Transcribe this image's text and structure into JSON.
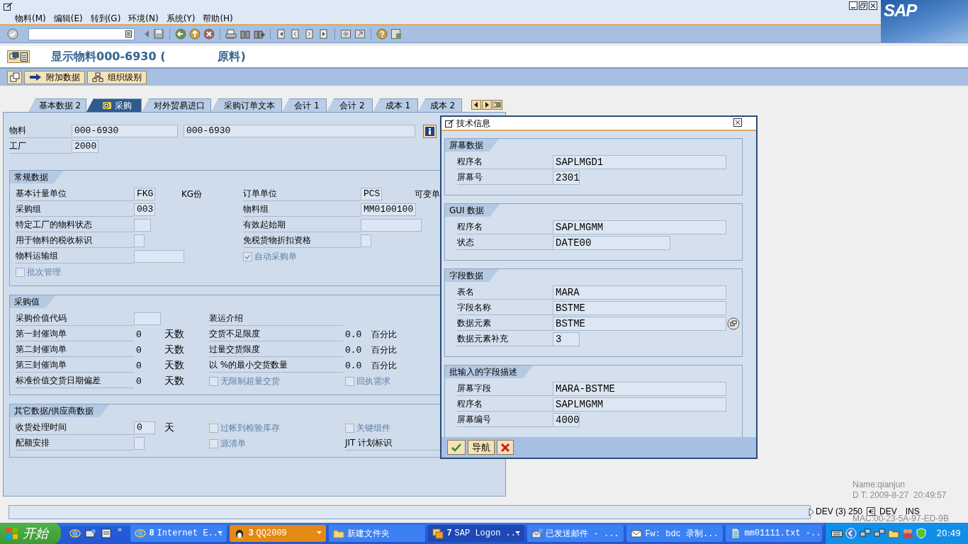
{
  "window": {
    "logo": "SAP"
  },
  "menu": [
    {
      "label": "物料(M)"
    },
    {
      "label": "编辑(E)"
    },
    {
      "label": "转到(G)"
    },
    {
      "label": "环境(N)"
    },
    {
      "label": "系统(Y)"
    },
    {
      "label": "帮助(H)"
    }
  ],
  "title": {
    "start": "显示物料000-6930 (",
    "end": "原料)"
  },
  "app_toolbar": [
    {
      "kind": "arrow",
      "label": "附加数据"
    },
    {
      "kind": "hierarchy",
      "label": "组织级别"
    }
  ],
  "tabs": [
    {
      "label": "基本数据 2",
      "selected": false
    },
    {
      "label": "采购",
      "selected": true
    },
    {
      "label": "对外贸易进口",
      "selected": false
    },
    {
      "label": "采购订单文本",
      "selected": false
    },
    {
      "label": "会计 1",
      "selected": false
    },
    {
      "label": "会计 2",
      "selected": false
    },
    {
      "label": "成本 1",
      "selected": false
    },
    {
      "label": "成本 2",
      "selected": false
    }
  ],
  "header": {
    "material_label": "物料",
    "material": "000-6930",
    "description": "000-6930",
    "plant_label": "工厂",
    "plant": "2000"
  },
  "groups": [
    {
      "title": "常规数据",
      "rows": [
        [
          {
            "kind": "field",
            "label": "基本计量单位",
            "value": "FKG",
            "unit": "KG份"
          },
          {
            "kind": "field",
            "label": "订单单位",
            "value": "PCS",
            "unit": "可变单"
          }
        ],
        [
          {
            "kind": "field",
            "label": "采购组",
            "value": "003"
          },
          {
            "kind": "field",
            "label": "物料组",
            "value": "MM0100100"
          }
        ],
        [
          {
            "kind": "field",
            "label": "特定工厂的物料状态"
          },
          {
            "kind": "field",
            "label": "有效起始期"
          }
        ],
        [
          {
            "kind": "field",
            "label": "用于物料的税收标识"
          },
          {
            "kind": "field",
            "label": "免税货物折扣资格"
          }
        ],
        [
          {
            "kind": "field",
            "label": "物料运输组"
          },
          {
            "kind": "checkbox",
            "label": "自动采购单",
            "checked": true,
            "disabled": true
          }
        ],
        [
          {
            "kind": "checkbox",
            "label": "批次管理",
            "checked": false,
            "disabled": true
          }
        ]
      ]
    },
    {
      "title": "采购值",
      "rows": [
        [
          {
            "kind": "field",
            "label": "采购价值代码"
          },
          {
            "kind": "label",
            "label": "装运介绍"
          }
        ],
        [
          {
            "kind": "output",
            "label": "第一封催询单",
            "value": "0",
            "unit": "天数"
          },
          {
            "kind": "output",
            "label": "交货不足限度",
            "value": "0.0",
            "unit": "百分比"
          }
        ],
        [
          {
            "kind": "output",
            "label": "第二封催询单",
            "value": "0",
            "unit": "天数"
          },
          {
            "kind": "output",
            "label": "过量交货限度",
            "value": "0.0",
            "unit": "百分比"
          }
        ],
        [
          {
            "kind": "output",
            "label": "第三封催询单",
            "value": "0",
            "unit": "天数"
          },
          {
            "kind": "output",
            "label": "以 %的最小交货数量",
            "value": "0.0",
            "unit": "百分比"
          }
        ],
        [
          {
            "kind": "output",
            "label": "标准价值交货日期偏差",
            "value": "0",
            "unit": "天数"
          },
          {
            "kind": "checkbox",
            "label": "无限制超量交货",
            "checked": false,
            "disabled": true
          },
          {
            "kind": "checkbox",
            "label": "回执需求",
            "checked": false,
            "disabled": true
          }
        ]
      ]
    },
    {
      "title": "其它数据/供应商数据",
      "rows": [
        [
          {
            "kind": "field",
            "label": "收货处理时间",
            "value": "0",
            "unit": "天"
          },
          {
            "kind": "checkbox",
            "label": "过帐到检验库存",
            "checked": false,
            "disabled": true
          },
          {
            "kind": "checkbox",
            "label": "关键组件",
            "checked": false,
            "disabled": true
          }
        ],
        [
          {
            "kind": "field",
            "label": "配额安排"
          },
          {
            "kind": "checkbox",
            "label": "源清单",
            "checked": false,
            "disabled": true
          },
          {
            "kind": "label",
            "label": "JIT 计划标识"
          }
        ]
      ]
    }
  ],
  "dialog": {
    "title": "技术信息",
    "groups": [
      {
        "title": "屏幕数据",
        "rows": [
          {
            "label": "程序名",
            "value": "SAPLMGD1"
          },
          {
            "label": "屏幕号",
            "value": "2301"
          }
        ]
      },
      {
        "title": "GUI 数据",
        "rows": [
          {
            "label": "程序名",
            "value": "SAPLMGMM"
          },
          {
            "label": "状态",
            "value": "DATE00"
          }
        ]
      },
      {
        "title": "字段数据",
        "rows": [
          {
            "label": "表名",
            "value": "MARA"
          },
          {
            "label": "字段名称",
            "value": "BSTME"
          },
          {
            "label": "数据元素",
            "value": "BSTME"
          },
          {
            "label": "数据元素补充",
            "value": "3"
          }
        ]
      },
      {
        "title": "批输入的字段描述",
        "rows": [
          {
            "label": "屏幕字段",
            "value": "MARA-BSTME"
          },
          {
            "label": "程序名",
            "value": "SAPLMGMM"
          },
          {
            "label": "屏幕编号",
            "value": "4000"
          }
        ]
      }
    ],
    "buttons": [
      {
        "kind": "confirm"
      },
      {
        "kind": "text",
        "label": "导航"
      },
      {
        "kind": "cancel"
      }
    ]
  },
  "status_bar": [
    "DEV (3) 250",
    "DEV",
    "INS"
  ],
  "desktop_info": [
    "Name:qianjun",
    "D T: 2009-8-27  20:49:57",
    "MAC:00-23-5A-97-ED-9B"
  ],
  "taskbar": {
    "start": "开始",
    "more": "»",
    "tasks": [
      {
        "kind": "browser",
        "count": "8",
        "label": "Internet E...",
        "grouped": true,
        "selected": false,
        "flashing": false
      },
      {
        "kind": "chat",
        "count": "3",
        "label": "QQ2009",
        "grouped": true,
        "selected": false,
        "flashing": true
      },
      {
        "kind": "folder",
        "label": "新建文件夹",
        "grouped": false,
        "selected": false,
        "flashing": false
      },
      {
        "kind": "app",
        "count": "7",
        "label": "SAP Logon ...",
        "grouped": true,
        "selected": true,
        "flashing": false
      },
      {
        "kind": "mailbox",
        "label": "已发送邮件 - ...",
        "grouped": false,
        "selected": false,
        "flashing": false
      },
      {
        "kind": "mail",
        "label": "Fw: bdc 录制...",
        "grouped": false,
        "selected": false,
        "flashing": false
      },
      {
        "kind": "document",
        "label": "mm01111.txt -...",
        "grouped": false,
        "selected": false,
        "flashing": false
      }
    ],
    "clock": "20:49"
  }
}
